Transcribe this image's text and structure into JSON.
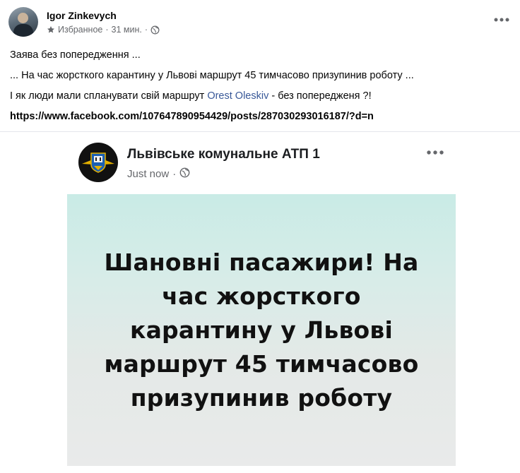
{
  "post": {
    "author": "Igor Zinkevych",
    "audience": "Избранное",
    "time": "31 мин.",
    "lines": [
      "Заява без попередження  ...",
      "... На час жорсткого карантину у Львові маршрут 45 тимчасово призупинив роботу ..."
    ],
    "line3_before": "І як люди мали спланувати свій маршрут ",
    "mention": "Orest Oleskiv",
    "line3_after": " - без попередженя ?!",
    "url": "https://www.facebook.com/107647890954429/posts/287030293016187/?d=n"
  },
  "shared": {
    "page_name": "Львівське комунальне АТП 1",
    "time": "Just now",
    "image_text": "Шановні пасажири! На час жорсткого карантину у Львові маршрут 45 тимчасово призупинив роботу"
  },
  "colors": {
    "link": "#385898",
    "meta": "#65676b",
    "image_top": "#c9ebe6",
    "image_bottom": "#e9eaea"
  },
  "icons": [
    "star-icon",
    "globe-icon",
    "more-options-icon"
  ]
}
